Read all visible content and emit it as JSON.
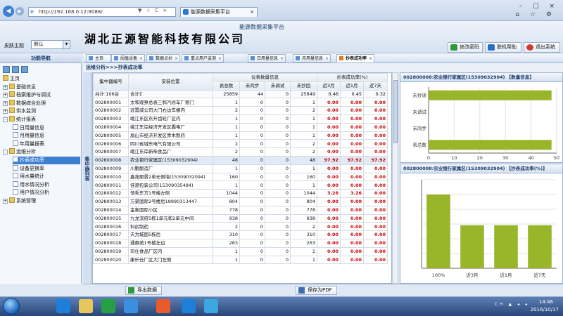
{
  "browser": {
    "url": "http://192.168.0.12:8088/",
    "addr_controls": "▼ ☆ C ×",
    "tab_title": "能源数据采集平台",
    "window_controls": "– □ ×",
    "window_controls2": "⌂ ☆ ⚙"
  },
  "header": {
    "platform_title": "能源数据采集平台",
    "company": "湖北正源智能科技有限公司",
    "skin_label": "皮肤主题",
    "skin_value": "默认",
    "buttons": [
      "修改密码",
      "联机帮助",
      "退出系统"
    ]
  },
  "sidebar": {
    "title": "功能导航",
    "items": [
      {
        "label": "主页",
        "level": 0,
        "expander": ""
      },
      {
        "label": "基础信息",
        "level": 0,
        "expander": "+"
      },
      {
        "label": "档案维护与调试",
        "level": 0,
        "expander": "+"
      },
      {
        "label": "数据综合处理",
        "level": 0,
        "expander": "+"
      },
      {
        "label": "供水监测",
        "level": 0,
        "expander": "+"
      },
      {
        "label": "统计报表",
        "level": 0,
        "expander": "-"
      },
      {
        "label": "日用量信息",
        "level": 1,
        "expander": ""
      },
      {
        "label": "月用量信息",
        "level": 1,
        "expander": ""
      },
      {
        "label": "年用量报表",
        "level": 1,
        "expander": ""
      },
      {
        "label": "运维分析",
        "level": 0,
        "expander": "-"
      },
      {
        "label": "抄表成功率",
        "level": 1,
        "expander": "",
        "selected": true
      },
      {
        "label": "设备更换率",
        "level": 1,
        "expander": ""
      },
      {
        "label": "用水量统计",
        "level": 1,
        "expander": ""
      },
      {
        "label": "用水情况分析",
        "level": 1,
        "expander": ""
      },
      {
        "label": "用户情况分析",
        "level": 1,
        "expander": ""
      },
      {
        "label": "系统管理",
        "level": 0,
        "expander": "+"
      }
    ]
  },
  "tabs": [
    {
      "label": "主页"
    },
    {
      "label": "阈值设备"
    },
    {
      "label": "数据点抄"
    },
    {
      "label": "重点用户监测"
    },
    {
      "label": "日用量信息"
    },
    {
      "label": "月用量信息"
    },
    {
      "label": "抄表成功率",
      "active": true
    }
  ],
  "breadcrumb": "运维分析>>>抄表成功率",
  "side_strip_label": "集中器列表",
  "table": {
    "headers": {
      "col_id": "集中器编号",
      "col_loc": "安装位置",
      "group_meters": "仪表数量信息",
      "group_rate": "抄表成功率(%)",
      "sub": [
        "表总数",
        "未同步",
        "未调试",
        "未抄回",
        "近3月",
        "近1月",
        "近7天"
      ]
    },
    "total": {
      "id": "共计:106台",
      "loc": "合计Σ",
      "total": "25859",
      "unsync": "44",
      "undebug": "0",
      "unread": "25849",
      "m3": "0.46",
      "m1": "0.45",
      "d7": "0.32"
    },
    "rows": [
      {
        "id": "002800001",
        "loc": "太和观察总表三和汽修车厂侧门",
        "total": "1",
        "unsync": "0",
        "undebug": "0",
        "unread": "1",
        "m3": "0.00",
        "m1": "0.00",
        "d7": "0.00"
      },
      {
        "id": "002800002",
        "loc": "远置威公司大门右边车棚内",
        "total": "2",
        "unsync": "0",
        "undebug": "0",
        "unread": "2",
        "m3": "0.00",
        "m1": "0.00",
        "d7": "0.00"
      },
      {
        "id": "002800003",
        "loc": "峨江东区东升齿轮厂区内",
        "total": "1",
        "unsync": "0",
        "undebug": "0",
        "unread": "1",
        "m3": "0.00",
        "m1": "0.00",
        "d7": "0.00"
      },
      {
        "id": "002800004",
        "loc": "峨江东岸经济开发区霸电厂",
        "total": "1",
        "unsync": "0",
        "undebug": "0",
        "unread": "1",
        "m3": "0.00",
        "m1": "0.00",
        "d7": "0.00"
      },
      {
        "id": "002800005",
        "loc": "眉山市经济开发区青木制药",
        "total": "1",
        "unsync": "0",
        "undebug": "0",
        "unread": "1",
        "m3": "0.00",
        "m1": "0.00",
        "d7": "0.00"
      },
      {
        "id": "002800006",
        "loc": "四川省城东电气有限公司",
        "total": "2",
        "unsync": "0",
        "undebug": "0",
        "unread": "2",
        "m3": "0.00",
        "m1": "0.00",
        "d7": "0.00"
      },
      {
        "id": "002800007",
        "loc": "峨江东岸新味食品厂",
        "total": "2",
        "unsync": "0",
        "undebug": "0",
        "unread": "2",
        "m3": "0.00",
        "m1": "0.00",
        "d7": "0.00"
      },
      {
        "id": "002800008",
        "loc": "农业银行家属区(15309032904)",
        "total": "48",
        "unsync": "0",
        "undebug": "0",
        "unread": "48",
        "m3": "97.92",
        "m1": "97.92",
        "d7": "97.92",
        "highlight": true
      },
      {
        "id": "002800009",
        "loc": "川鹏酿造厂",
        "total": "1",
        "unsync": "0",
        "undebug": "0",
        "unread": "1",
        "m3": "0.00",
        "m1": "0.00",
        "d7": "0.00"
      },
      {
        "id": "002800010",
        "loc": "鑫苑丽景2单元侧墙(15309032094)",
        "total": "160",
        "unsync": "0",
        "undebug": "0",
        "unread": "160",
        "m3": "0.00",
        "m1": "0.00",
        "d7": "0.00"
      },
      {
        "id": "002800011",
        "loc": "佳源包装公司(15309035484)",
        "total": "1",
        "unsync": "0",
        "undebug": "0",
        "unread": "1",
        "m3": "0.00",
        "m1": "0.00",
        "d7": "0.00"
      },
      {
        "id": "002800012",
        "loc": "领秀东方1号楼左侧",
        "total": "1044",
        "unsync": "0",
        "undebug": "0",
        "unread": "1044",
        "m3": "3.26",
        "m1": "3.26",
        "d7": "0.00"
      },
      {
        "id": "002800013",
        "loc": "万景国际2号楼后18990313447",
        "total": "804",
        "unsync": "0",
        "undebug": "0",
        "unread": "804",
        "m3": "0.00",
        "m1": "0.00",
        "d7": "0.00"
      },
      {
        "id": "002800014",
        "loc": "金象国际小区",
        "total": "778",
        "unsync": "0",
        "undebug": "0",
        "unread": "778",
        "m3": "0.00",
        "m1": "0.00",
        "d7": "0.00"
      },
      {
        "id": "002800015",
        "loc": "九龙滨府5栋1单元和2单元中间",
        "total": "938",
        "unsync": "0",
        "undebug": "0",
        "unread": "938",
        "m3": "0.00",
        "m1": "0.00",
        "d7": "0.00"
      },
      {
        "id": "002800016",
        "loc": "科创制药",
        "total": "2",
        "unsync": "0",
        "undebug": "0",
        "unread": "2",
        "m3": "0.00",
        "m1": "0.00",
        "d7": "0.00"
      },
      {
        "id": "002800017",
        "loc": "天为城国5栋后",
        "total": "310",
        "unsync": "0",
        "undebug": "0",
        "unread": "310",
        "m3": "0.00",
        "m1": "0.00",
        "d7": "0.00"
      },
      {
        "id": "002800018",
        "loc": "通惠苑1号楼左边",
        "total": "263",
        "unsync": "0",
        "undebug": "0",
        "unread": "263",
        "m3": "0.00",
        "m1": "0.00",
        "d7": "0.00"
      },
      {
        "id": "002800019",
        "loc": "邓仕食品厂区内",
        "total": "1",
        "unsync": "0",
        "undebug": "0",
        "unread": "1",
        "m3": "0.00",
        "m1": "0.00",
        "d7": "0.00"
      },
      {
        "id": "002800020",
        "loc": "康乐仕厂区大门左侧",
        "total": "1",
        "unsync": "0",
        "undebug": "0",
        "unread": "1",
        "m3": "0.00",
        "m1": "0.00",
        "d7": "0.00"
      }
    ]
  },
  "chart_data": [
    {
      "type": "bar",
      "orientation": "horizontal",
      "title": "002800008:农业银行家属区(15309032904) 【数量信息】",
      "categories": [
        "未抄读",
        "未调试",
        "未同步",
        "表总数"
      ],
      "values": [
        48,
        0,
        0,
        48
      ],
      "xticks": [
        "0",
        "10",
        "20",
        "30",
        "40",
        "50"
      ],
      "xlim": [
        0,
        50
      ],
      "color": "#99b62b",
      "grid": true
    },
    {
      "type": "bar",
      "orientation": "vertical",
      "title": "002800008:农业银行家属区(15309032904) 【抄表成功率(%)】",
      "categories": [
        "100%",
        "近3月",
        "近1月",
        "近7天"
      ],
      "values": [
        100,
        97.92,
        97.92,
        97.92
      ],
      "ylim": [
        95,
        101
      ],
      "color": "#99b62b",
      "grid": true
    }
  ],
  "footer_buttons": {
    "export": "导出数据",
    "pdf": "保存为PDF"
  },
  "taskbar": {
    "tray": "CH ▲ ◂ ◂",
    "time": "14:46",
    "date": "2016/10/17"
  },
  "colors": {
    "accent": "#3c7fd1",
    "bar": "#99b62b",
    "rate_red": "#d00000"
  }
}
